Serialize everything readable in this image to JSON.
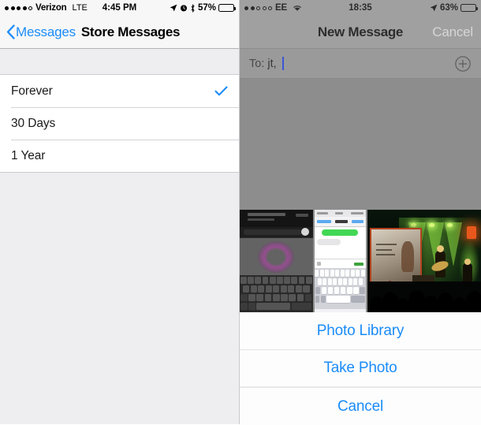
{
  "left_phone": {
    "status_bar": {
      "signal_dots_filled": 4,
      "signal_dots_total": 5,
      "carrier": "Verizon",
      "network": "LTE",
      "time": "4:45 PM",
      "icons": [
        "location-arrow-icon",
        "alarm-clock-icon",
        "bluetooth-icon"
      ],
      "battery_percent": "57%",
      "battery_level": 57
    },
    "nav": {
      "back_label": "Messages",
      "title": "Store Messages"
    },
    "options": [
      {
        "label": "Forever",
        "selected": true
      },
      {
        "label": "30 Days",
        "selected": false
      },
      {
        "label": "1 Year",
        "selected": false
      }
    ],
    "accent_color": "#1b8cf9",
    "background_color": "#eeeef1"
  },
  "right_phone": {
    "status_bar": {
      "signal_dots_filled": 2,
      "signal_dots_total": 5,
      "carrier": "EE",
      "network": "wifi-icon",
      "time": "18:35",
      "icons": [
        "location-arrow-icon"
      ],
      "battery_percent": "63%",
      "battery_level": 63
    },
    "nav": {
      "title": "New Message",
      "cancel_label": "Cancel"
    },
    "to_field": {
      "label": "To:",
      "value": "jt,",
      "add_contact_icon": "plus-circle-icon"
    },
    "photo_strip": [
      {
        "name": "thumbnail-dark-screenshot"
      },
      {
        "name": "thumbnail-imessage-screenshot"
      },
      {
        "name": "thumbnail-concert-photo"
      }
    ],
    "action_sheet": [
      {
        "label": "Photo Library"
      },
      {
        "label": "Take Photo"
      },
      {
        "label": "Cancel"
      }
    ],
    "accent_color": "#1b8cf9",
    "dim_overlay_color": "#8d8d8d"
  }
}
